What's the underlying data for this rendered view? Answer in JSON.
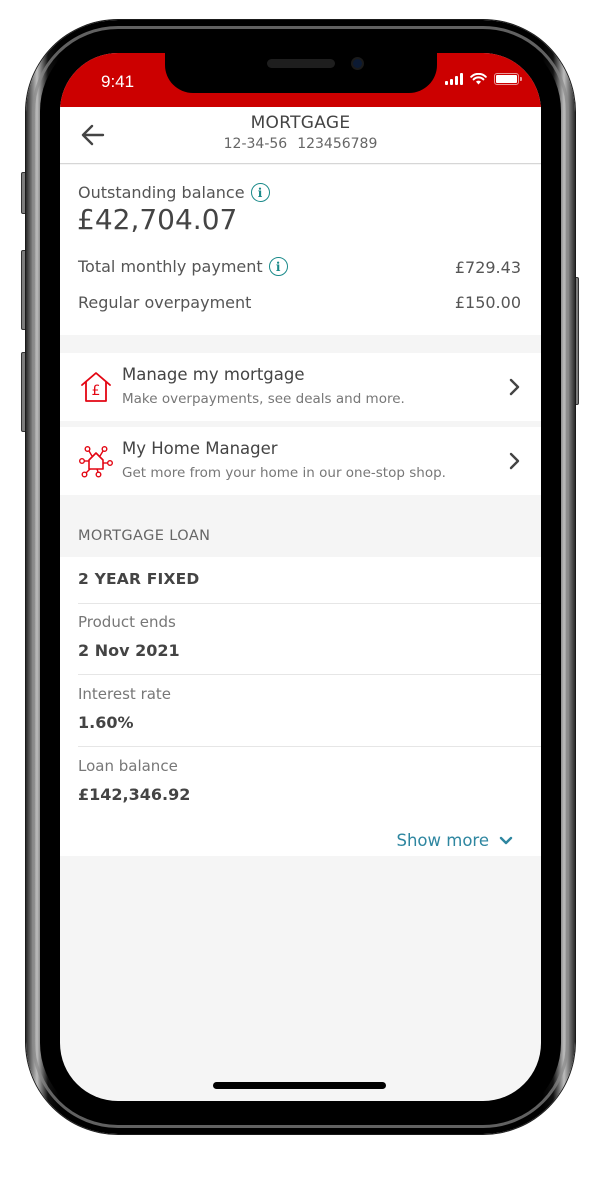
{
  "status_bar": {
    "time": "9:41",
    "icons": [
      "signal-icon",
      "wifi-icon",
      "battery-icon"
    ],
    "background_color": "#cc0000"
  },
  "header": {
    "back_icon": "arrow-left-icon",
    "title": "MORTGAGE",
    "sort_code": "12-34-56",
    "account_number": "123456789"
  },
  "summary": {
    "outstanding_label": "Outstanding balance",
    "outstanding_value": "£42,704.07",
    "monthly_label": "Total monthly payment",
    "monthly_value": "£729.43",
    "overpayment_label": "Regular overpayment",
    "overpayment_value": "£150.00",
    "info_icon_glyph": "i"
  },
  "menu": [
    {
      "icon": "house-pound-icon",
      "title": "Manage my mortgage",
      "subtitle": "Make overpayments, see deals and more."
    },
    {
      "icon": "connected-home-icon",
      "title": "My Home Manager",
      "subtitle": "Get more from your home in our one-stop shop."
    }
  ],
  "loan_section": {
    "heading": "MORTGAGE LOAN",
    "product": "2 YEAR FIXED",
    "details": [
      {
        "label": "Product ends",
        "value": "2 Nov 2021"
      },
      {
        "label": "Interest rate",
        "value": "1.60%"
      },
      {
        "label": "Loan balance",
        "value": "£142,346.92"
      }
    ],
    "show_more_label": "Show more"
  },
  "colors": {
    "brand_red": "#cc0000",
    "accent_teal": "#1a8a8a",
    "link_blue": "#2e86a0"
  }
}
